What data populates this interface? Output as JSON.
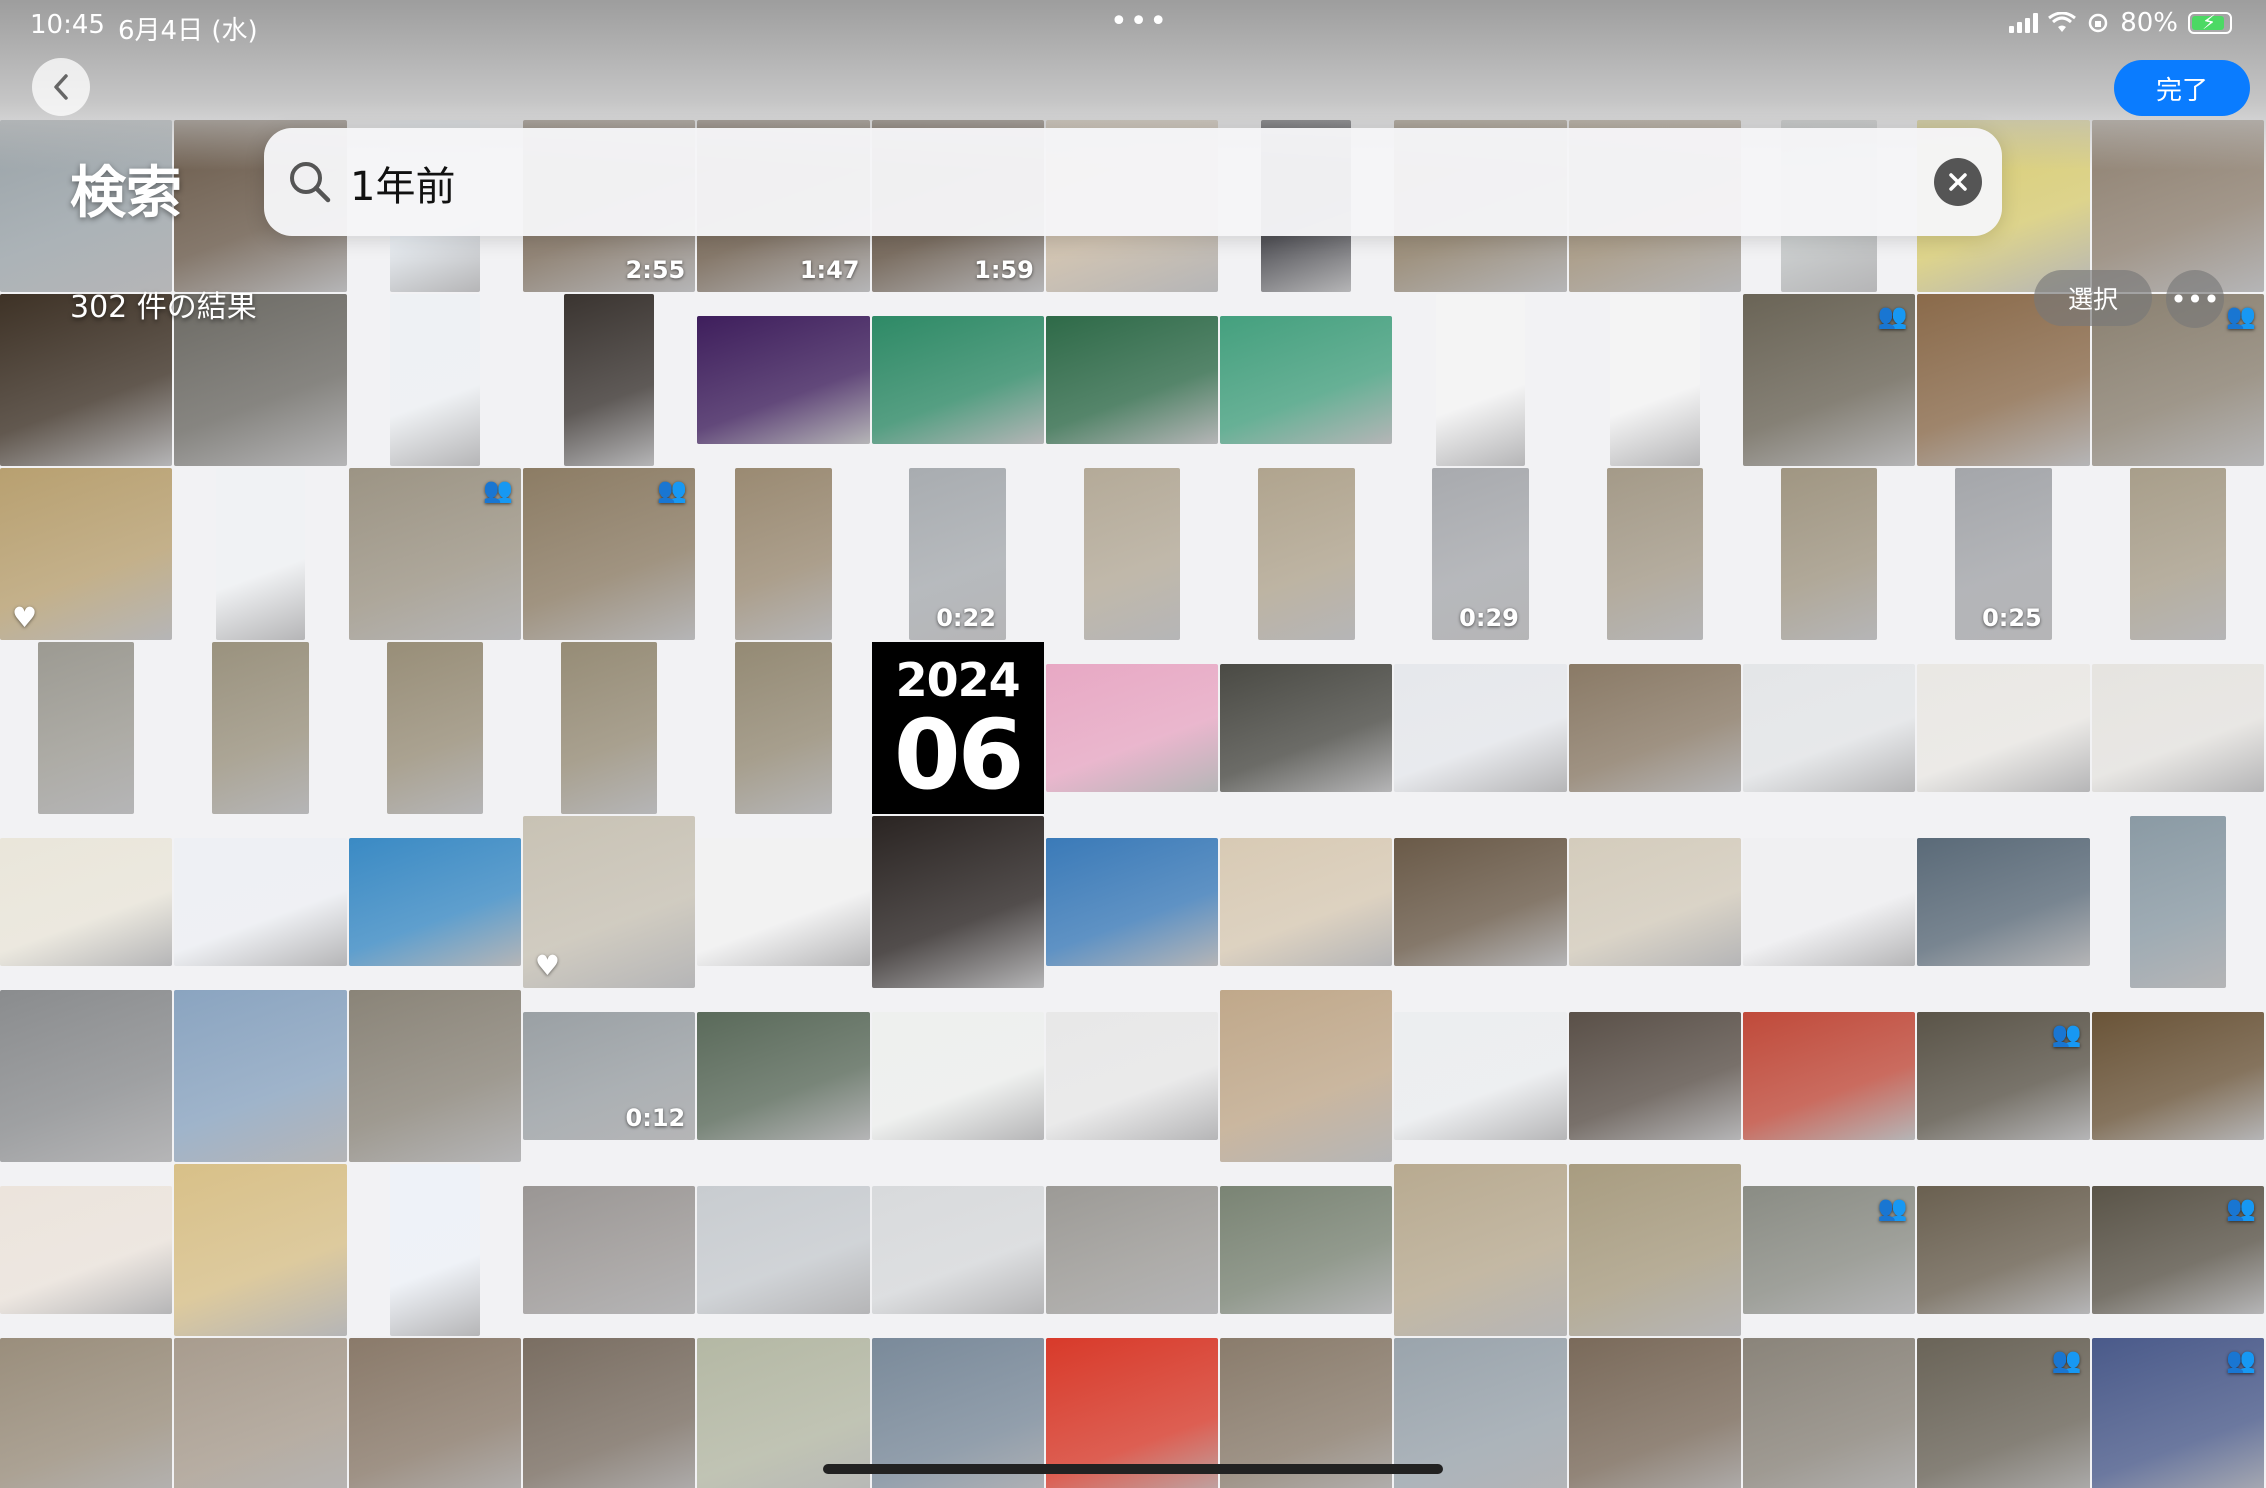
{
  "status_bar": {
    "time": "10:45",
    "date": "6月4日 (水)",
    "multitask": "•••",
    "battery": "80%"
  },
  "nav": {
    "back_icon": "chevron-left-icon",
    "done_label": "完了"
  },
  "search": {
    "title": "検索",
    "query": "1年前",
    "result_count": "302 件の結果",
    "clear_icon": "xmark-circle-icon"
  },
  "toolbar": {
    "select_label": "選択",
    "more_label": "•••"
  },
  "highlight_tile": {
    "year": "2024",
    "month": "06"
  },
  "colors": {
    "accent": "#0a7cff",
    "battery": "#4cd964"
  },
  "rows": [
    [
      {
        "c": "#9aa3a8"
      },
      {
        "c": "#6a5a4a"
      },
      {
        "c": "#e8eef4",
        "doc": true
      },
      {
        "c": "#7a6a58",
        "d": "2:55"
      },
      {
        "c": "#6b5a48",
        "d": "1:47"
      },
      {
        "c": "#5e4e3e",
        "d": "1:59"
      },
      {
        "c": "#c8b8a2"
      },
      {
        "c": "#2d2d33",
        "doc": true
      },
      {
        "c": "#8a7a62"
      },
      {
        "c": "#9c8c74"
      },
      {
        "c": "#c4c8c8",
        "portrait": true
      },
      {
        "c": "#d8cc72"
      },
      {
        "c": "#8e8070"
      }
    ],
    [
      {
        "c": "#3e3226"
      },
      {
        "c": "#6c6a64"
      },
      {
        "c": "#eef1f4",
        "doc": true
      },
      {
        "c": "#3a3430",
        "doc": true
      },
      {
        "c": "#3e1e5c",
        "short": true
      },
      {
        "c": "#2e8a66",
        "short": true
      },
      {
        "c": "#2e6a48",
        "short": true
      },
      {
        "c": "#44a07e",
        "short": true
      },
      {
        "c": "#f4f4f4",
        "doc": true
      },
      {
        "c": "#f4f4f4",
        "doc": true
      },
      {
        "c": "#6a6456",
        "people": true
      },
      {
        "c": "#8a6a4a"
      },
      {
        "c": "#8a8070",
        "people": true
      }
    ],
    [
      {
        "c": "#b8a070",
        "heart": true
      },
      {
        "c": "#f0f2f4",
        "doc": true
      },
      {
        "c": "#9c9484",
        "people": true
      },
      {
        "c": "#8c7c64",
        "people": true
      },
      {
        "c": "#9a8a72",
        "portrait": true
      },
      {
        "c": "#a8acb0",
        "portrait": true,
        "d": "0:22"
      },
      {
        "c": "#b4aa98",
        "portrait": true
      },
      {
        "c": "#b0a48e",
        "portrait": true
      },
      {
        "c": "#a8aaae",
        "portrait": true,
        "d": "0:29"
      },
      {
        "c": "#a49a88",
        "portrait": true
      },
      {
        "c": "#a09682",
        "portrait": true
      },
      {
        "c": "#a4a6aa",
        "portrait": true,
        "d": "0:25"
      },
      {
        "c": "#a89e8a",
        "portrait": true
      }
    ],
    [
      {
        "c": "#9c9a92",
        "portrait": true
      },
      {
        "c": "#9a927e",
        "portrait": true
      },
      {
        "c": "#988e78",
        "portrait": true
      },
      {
        "c": "#968c76",
        "portrait": true
      },
      {
        "c": "#948a74",
        "portrait": true
      },
      {
        "tile2024": true
      },
      {
        "c": "#e8a8c4",
        "short": true
      },
      {
        "c": "#4a4a44",
        "short": true
      },
      {
        "c": "#e6e8ec",
        "short": true
      },
      {
        "c": "#8a7a66",
        "short": true
      },
      {
        "c": "#e4e6e8",
        "short": true
      },
      {
        "c": "#eae8e4",
        "short": true
      },
      {
        "c": "#e6e4e0",
        "short": true
      }
    ],
    [
      {
        "c": "#eae6da",
        "short": true
      },
      {
        "c": "#eef0f4",
        "short": true
      },
      {
        "c": "#3a8ac4",
        "short": true
      },
      {
        "c": "#c8c2b4",
        "heart": true
      },
      {
        "c": "#f2f2f2",
        "short": true
      },
      {
        "c": "#2a2422"
      },
      {
        "c": "#3a7ab8",
        "short": true
      },
      {
        "c": "#d8cab4",
        "short": true
      },
      {
        "c": "#6a5a48",
        "short": true
      },
      {
        "c": "#d4ccbc",
        "short": true
      },
      {
        "c": "#f0f0f2",
        "short": true
      },
      {
        "c": "#5a6a78",
        "short": true
      },
      {
        "c": "#8a9aa4",
        "portrait": true
      }
    ],
    [
      {
        "c": "#8a8c8e"
      },
      {
        "c": "#8aa4c0"
      },
      {
        "c": "#8a8478"
      },
      {
        "c": "#9aa0a4",
        "short": true,
        "d": "0:12"
      },
      {
        "c": "#5a6a5a",
        "short": true
      },
      {
        "c": "#eef0ee",
        "short": true
      },
      {
        "c": "#e8e8e8",
        "short": true
      },
      {
        "c": "#c0a88a"
      },
      {
        "c": "#eceef0",
        "short": true
      },
      {
        "c": "#5a5048",
        "short": true
      },
      {
        "c": "#c04a3a",
        "short": true
      },
      {
        "c": "#5a5448",
        "short": true,
        "people": true
      },
      {
        "c": "#6a5438",
        "short": true
      }
    ],
    [
      {
        "c": "#ece4dc",
        "short": true
      },
      {
        "c": "#d8c088"
      },
      {
        "c": "#eef2f8",
        "doc": true
      },
      {
        "c": "#9a9694",
        "short": true
      },
      {
        "c": "#c8ccd0",
        "short": true
      },
      {
        "c": "#d8dadc",
        "short": true
      },
      {
        "c": "#9c9a96",
        "short": true
      },
      {
        "c": "#7a8474",
        "short": true
      },
      {
        "c": "#b8aa90"
      },
      {
        "c": "#a89c80"
      },
      {
        "c": "#8a8c84",
        "short": true,
        "people": true
      },
      {
        "c": "#6a6050",
        "short": true
      },
      {
        "c": "#5a5448",
        "short": true,
        "people": true
      }
    ],
    [
      {
        "c": "#9a8e7c"
      },
      {
        "c": "#a89c8e"
      },
      {
        "c": "#8a7a6a"
      },
      {
        "c": "#7a6e62"
      },
      {
        "c": "#b4b8a4"
      },
      {
        "c": "#7a8a9a"
      },
      {
        "c": "#d83a2a"
      },
      {
        "c": "#8a7c6c"
      },
      {
        "c": "#9aa4ac"
      },
      {
        "c": "#7a6a5a"
      },
      {
        "c": "#8a847a"
      },
      {
        "c": "#6a6458",
        "people": true
      },
      {
        "c": "#4a5a8a",
        "people": true
      }
    ]
  ]
}
